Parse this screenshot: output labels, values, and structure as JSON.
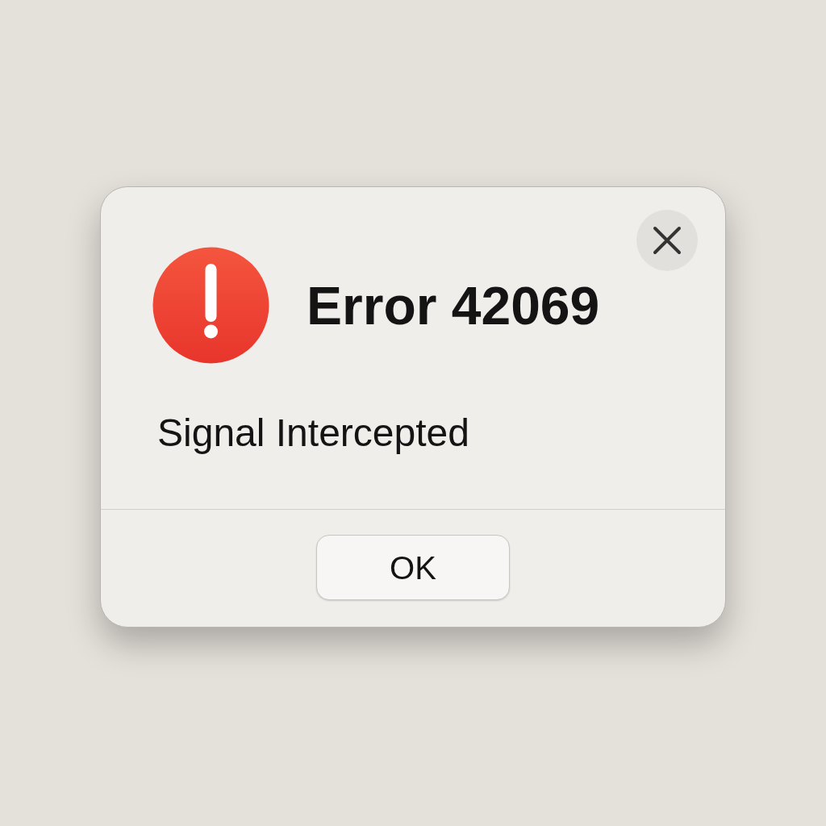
{
  "dialog": {
    "title": "Error 42069",
    "message": "Signal Intercepted",
    "buttons": [
      "OK"
    ]
  }
}
